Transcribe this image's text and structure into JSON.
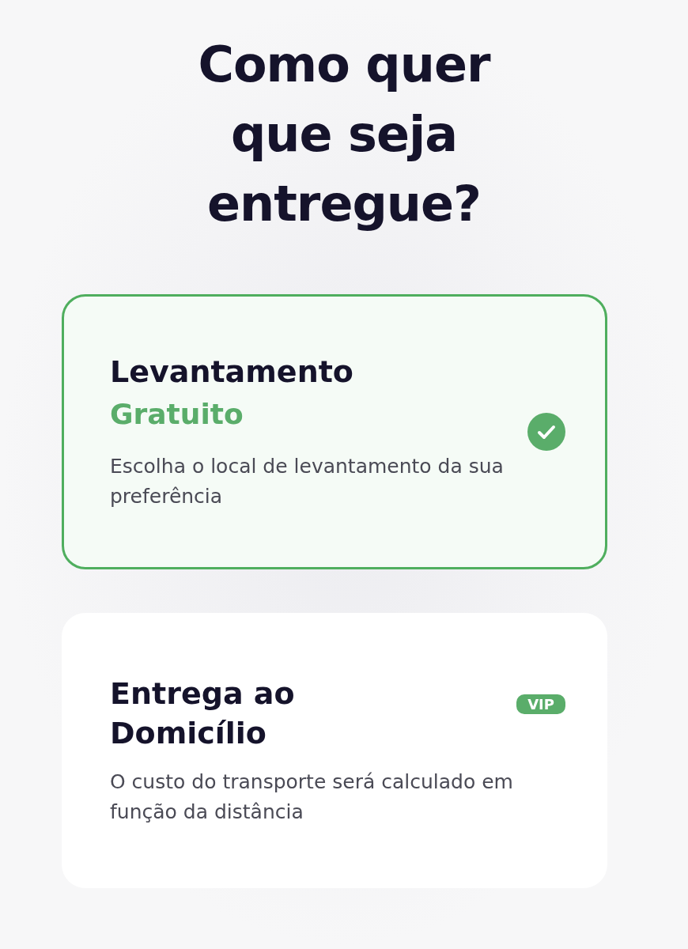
{
  "heading": "Como quer que seja entregue?",
  "options": [
    {
      "title": "Levantamento",
      "price": "Gratuito",
      "description": "Escolha o local de levantamento da sua preferência",
      "selected": true
    },
    {
      "title": "Entrega ao Domicílio",
      "badge": "VIP",
      "description": "O custo do transporte será calculado em função da distância",
      "selected": false
    }
  ]
}
